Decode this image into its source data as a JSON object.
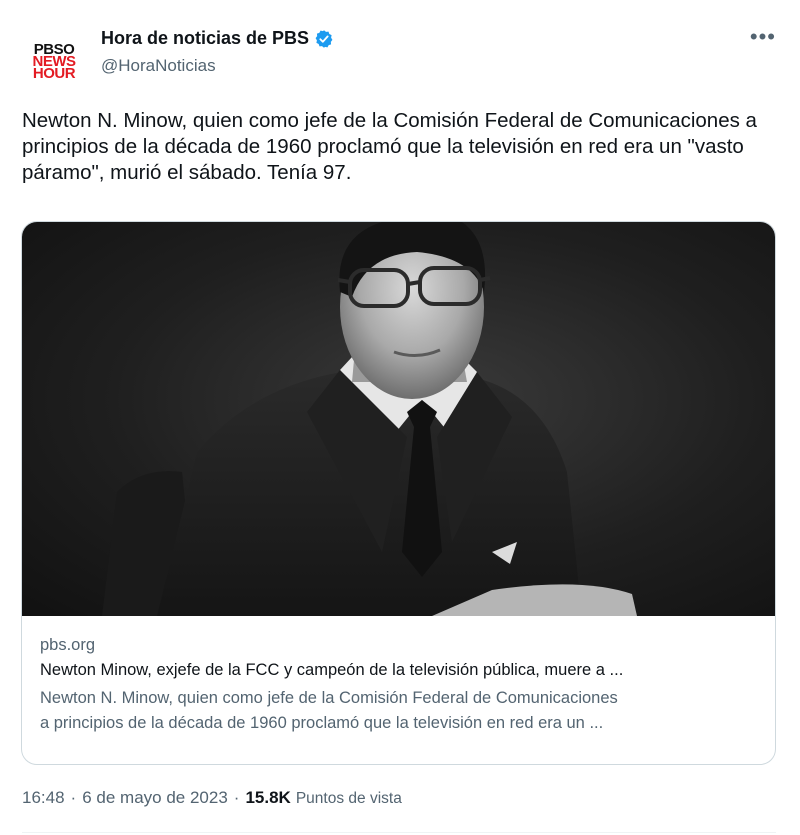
{
  "account": {
    "avatar_lines": [
      "PBSO",
      "NEWS",
      "HOUR"
    ],
    "display_name": "Hora de noticias de PBS",
    "handle": "@HoraNoticias",
    "verified": true
  },
  "more_icon": "more-horizontal-icon",
  "tweet_text": "Newton N. Minow, quien como jefe de la Comisión Federal de Comunicaciones a principios de la década de 1960 proclamó que la televisión en red era un \"vasto páramo\", murió el sábado. Tenía 97.",
  "card": {
    "domain": "pbs.org",
    "title": "Newton Minow, exjefe de la FCC y campeón de la televisión pública, muere a ...",
    "description_line1": "Newton N. Minow, quien como jefe de la Comisión Federal de Comunicaciones",
    "description_line2": "a principios de la década de 1960 proclamó que la televisión en red era un ..."
  },
  "footer": {
    "time": "16:48",
    "separator": "·",
    "date": "6 de mayo de 2023",
    "views_count": "15.8K",
    "views_label": "Puntos de vista"
  },
  "colors": {
    "verified_blue": "#1d9bf0",
    "brand_red": "#e31b23",
    "secondary_text": "#536471"
  }
}
